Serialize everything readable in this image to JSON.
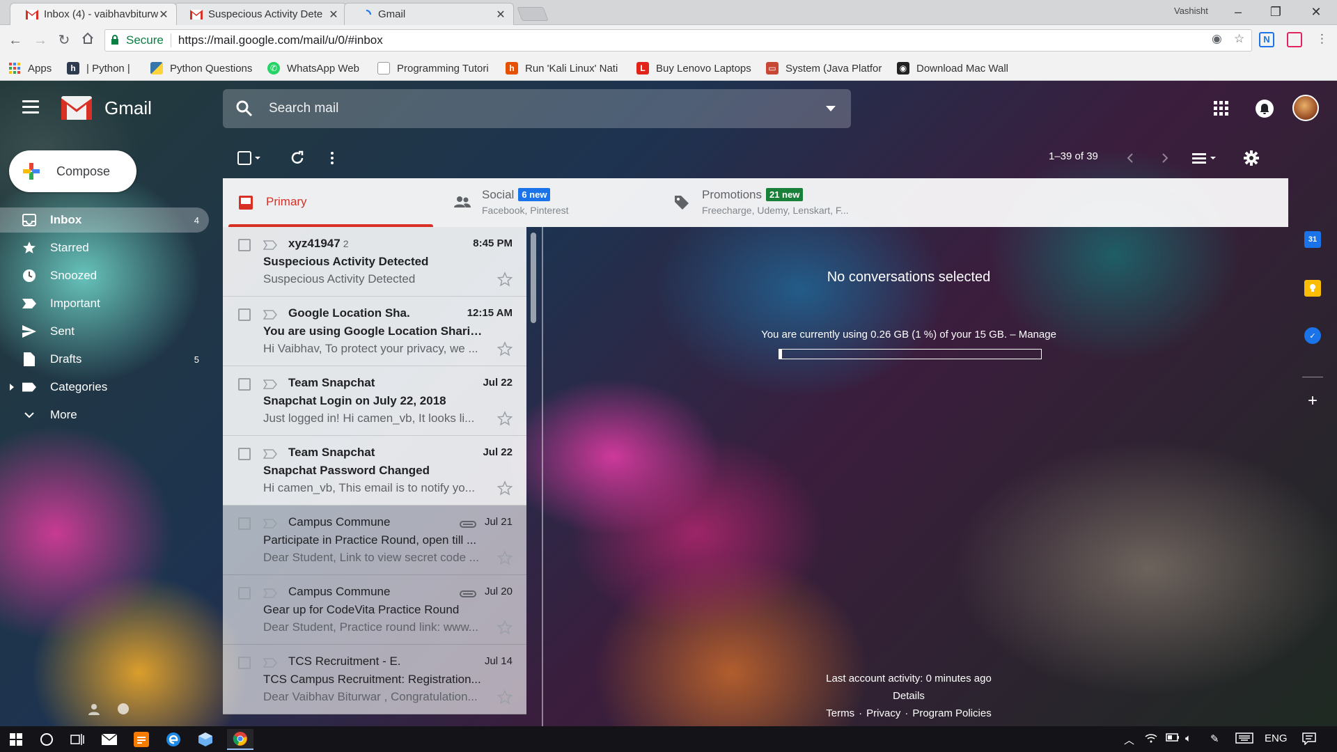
{
  "browser": {
    "tabs": [
      {
        "title": "Inbox (4) - vaibhavbiturw",
        "active": true
      },
      {
        "title": "Suspecious Activity Dete",
        "active": false
      },
      {
        "title": "Gmail",
        "active": false
      }
    ],
    "profile_name": "Vashisht",
    "secure_label": "Secure",
    "url": "https://mail.google.com/mail/u/0/#inbox",
    "bookmarks": [
      {
        "label": "Apps",
        "icon": "apps-grid-icon"
      },
      {
        "label": "| Python |",
        "icon": "hackerrank-icon"
      },
      {
        "label": "Python Questions",
        "icon": "python-icon"
      },
      {
        "label": "WhatsApp Web",
        "icon": "whatsapp-icon"
      },
      {
        "label": "Programming Tutori",
        "icon": "page-icon"
      },
      {
        "label": "Run 'Kali Linux' Nati",
        "icon": "kali-icon"
      },
      {
        "label": "Buy Lenovo Laptops",
        "icon": "lenovo-icon"
      },
      {
        "label": "System (Java Platfor",
        "icon": "oracle-icon"
      },
      {
        "label": "Download Mac Wall",
        "icon": "camera-icon"
      }
    ]
  },
  "gmail": {
    "brand": "Gmail",
    "search_placeholder": "Search mail",
    "compose_label": "Compose",
    "nav": [
      {
        "label": "Inbox",
        "count": "4",
        "icon": "inbox-icon",
        "active": true
      },
      {
        "label": "Starred",
        "count": "",
        "icon": "star-icon",
        "active": false
      },
      {
        "label": "Snoozed",
        "count": "",
        "icon": "clock-icon",
        "active": false
      },
      {
        "label": "Important",
        "count": "",
        "icon": "important-icon",
        "active": false
      },
      {
        "label": "Sent",
        "count": "",
        "icon": "send-icon",
        "active": false
      },
      {
        "label": "Drafts",
        "count": "5",
        "icon": "draft-icon",
        "active": false
      },
      {
        "label": "Categories",
        "count": "",
        "icon": "label-icon",
        "active": false
      },
      {
        "label": "More",
        "count": "",
        "icon": "chevron-down-icon",
        "active": false
      }
    ],
    "pager": "1–39 of 39",
    "categories": [
      {
        "title": "Primary",
        "badge": "",
        "subtitle": ""
      },
      {
        "title": "Social",
        "badge": "6 new",
        "subtitle": "Facebook, Pinterest"
      },
      {
        "title": "Promotions",
        "badge": "21 new",
        "subtitle": "Freecharge, Udemy, Lenskart, F..."
      }
    ],
    "colors": {
      "social_badge": "#1a73e8",
      "promotions_badge": "#188038",
      "primary_accent": "#d93025"
    },
    "emails": [
      {
        "sender": "xyz41947",
        "thread_count": "2",
        "date": "8:45 PM",
        "subject": "Suspecious Activity Detected",
        "snippet": "Suspecious Activity Detected",
        "unread": true,
        "attachment": false
      },
      {
        "sender": "Google Location Sha.",
        "thread_count": "",
        "date": "12:15 AM",
        "subject": "You are using Google Location Sharin...",
        "snippet": "Hi Vaibhav, To protect your privacy, we ...",
        "unread": true,
        "attachment": false
      },
      {
        "sender": "Team Snapchat",
        "thread_count": "",
        "date": "Jul 22",
        "subject": "Snapchat Login on July 22, 2018",
        "snippet": "Just logged in! Hi camen_vb, It looks li...",
        "unread": true,
        "attachment": false
      },
      {
        "sender": "Team Snapchat",
        "thread_count": "",
        "date": "Jul 22",
        "subject": "Snapchat Password Changed",
        "snippet": "Hi camen_vb, This email is to notify yo...",
        "unread": true,
        "attachment": false
      },
      {
        "sender": "Campus Commune",
        "thread_count": "",
        "date": "Jul 21",
        "subject": "Participate in Practice Round, open till ...",
        "snippet": "Dear Student, Link to view secret code ...",
        "unread": false,
        "attachment": true
      },
      {
        "sender": "Campus Commune",
        "thread_count": "",
        "date": "Jul 20",
        "subject": "Gear up for CodeVita Practice Round",
        "snippet": "Dear Student, Practice round link: www...",
        "unread": false,
        "attachment": true
      },
      {
        "sender": "TCS Recruitment - E.",
        "thread_count": "",
        "date": "Jul 14",
        "subject": "TCS Campus Recruitment: Registration...",
        "snippet": "Dear Vaibhav Biturwar , Congratulation...",
        "unread": false,
        "attachment": false
      }
    ],
    "reading_pane": {
      "empty_text": "No conversations selected",
      "storage_text": "You are currently using 0.26 GB (1 %) of your 15 GB. – Manage",
      "storage_fraction": 0.01,
      "last_activity": "Last account activity: 0 minutes ago",
      "details": "Details",
      "links": [
        "Terms",
        "·",
        "Privacy",
        "·",
        "Program Policies"
      ]
    }
  },
  "taskbar": {
    "language": "ENG"
  }
}
